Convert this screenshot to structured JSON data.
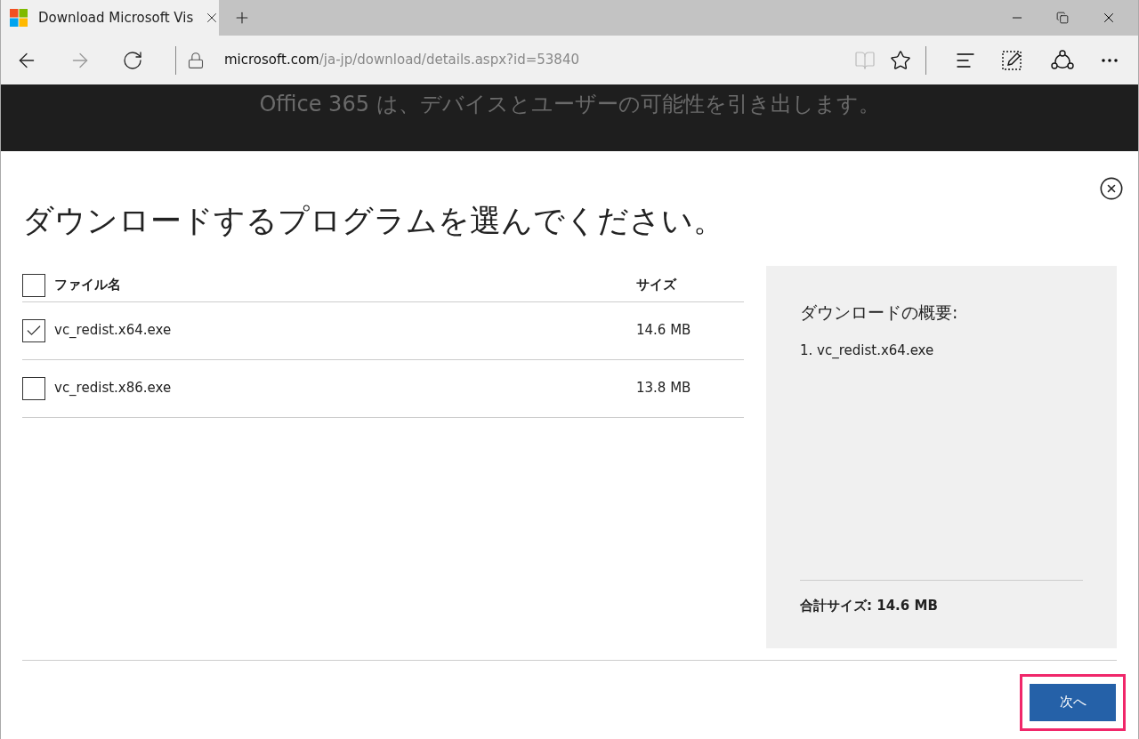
{
  "browser": {
    "tab": {
      "title": "Download Microsoft Vis",
      "selected": true
    },
    "address": {
      "domain": "microsoft.com",
      "path": "/ja-jp/download/details.aspx?id=53840"
    }
  },
  "banner": {
    "text": "Office 365 は、デバイスとユーザーの可能性を引き出します。"
  },
  "dialog": {
    "title": "ダウンロードするプログラムを選んでください。",
    "table": {
      "select_all": {
        "checked": false
      },
      "columns": [
        "ファイル名",
        "サイズ"
      ],
      "rows": [
        {
          "name": "vc_redist.x64.exe",
          "size": "14.6 MB",
          "checked": true
        },
        {
          "name": "vc_redist.x86.exe",
          "size": "13.8 MB",
          "checked": false
        }
      ]
    },
    "summary": {
      "heading": "ダウンロードの概要:",
      "items": [
        "1. vc_redist.x64.exe"
      ],
      "total": "合計サイズ: 14.6 MB"
    },
    "next_button": {
      "label": "次へ",
      "highlighted": true
    }
  }
}
